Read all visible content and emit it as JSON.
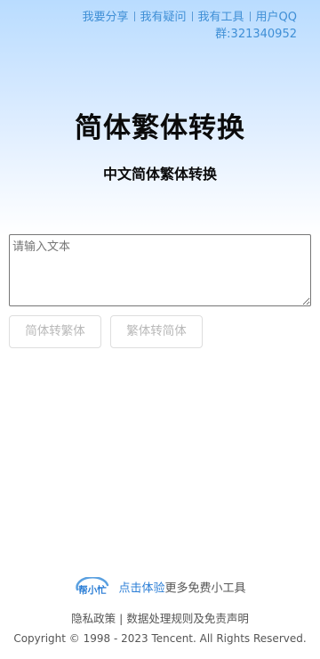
{
  "nav": {
    "share": "我要分享",
    "question": "我有疑问",
    "tools": "我有工具",
    "qq_group": "用户QQ",
    "qq_number": "群:321340952"
  },
  "page": {
    "title": "简体繁体转换",
    "subtitle": "中文简体繁体转换"
  },
  "input": {
    "placeholder": "请输入文本",
    "value": ""
  },
  "buttons": {
    "to_traditional": "简体转繁体",
    "to_simplified": "繁体转简体"
  },
  "footer": {
    "logo_text": "帮小忙",
    "promo_link": "点击体验",
    "promo_text": "更多免费小工具",
    "privacy": "隐私政策",
    "separator": "|",
    "data_rules": "数据处理规则及免责声明",
    "copyright": "Copyright © 1998 - 2023 Tencent. All Rights Reserved."
  },
  "colors": {
    "link_blue": "#3f8fd6",
    "logo_blue": "#2b7ed6"
  }
}
